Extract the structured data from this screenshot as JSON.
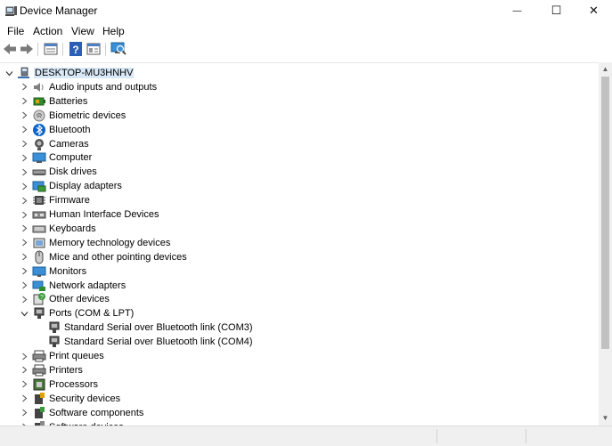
{
  "window": {
    "title": "Device Manager"
  },
  "window_controls": {
    "minimize": "—",
    "maximize": "☐",
    "close": "✕"
  },
  "menu": {
    "items": [
      "File",
      "Action",
      "View",
      "Help"
    ]
  },
  "tree": {
    "root": "DESKTOP-MU3HNHV",
    "categories": [
      {
        "label": "Audio inputs and outputs",
        "icon": "speaker-icon",
        "expanded": false
      },
      {
        "label": "Batteries",
        "icon": "battery-icon",
        "expanded": false
      },
      {
        "label": "Biometric devices",
        "icon": "fingerprint-icon",
        "expanded": false
      },
      {
        "label": "Bluetooth",
        "icon": "bluetooth-icon",
        "expanded": false
      },
      {
        "label": "Cameras",
        "icon": "camera-icon",
        "expanded": false
      },
      {
        "label": "Computer",
        "icon": "computer-icon",
        "expanded": false
      },
      {
        "label": "Disk drives",
        "icon": "disk-drive-icon",
        "expanded": false
      },
      {
        "label": "Display adapters",
        "icon": "display-adapter-icon",
        "expanded": false
      },
      {
        "label": "Firmware",
        "icon": "firmware-icon",
        "expanded": false
      },
      {
        "label": "Human Interface Devices",
        "icon": "hid-icon",
        "expanded": false
      },
      {
        "label": "Keyboards",
        "icon": "keyboard-icon",
        "expanded": false
      },
      {
        "label": "Memory technology devices",
        "icon": "memory-icon",
        "expanded": false
      },
      {
        "label": "Mice and other pointing devices",
        "icon": "mouse-icon",
        "expanded": false
      },
      {
        "label": "Monitors",
        "icon": "monitor-icon",
        "expanded": false
      },
      {
        "label": "Network adapters",
        "icon": "network-adapter-icon",
        "expanded": false
      },
      {
        "label": "Other devices",
        "icon": "unknown-device-icon",
        "expanded": false
      },
      {
        "label": "Ports (COM & LPT)",
        "icon": "port-icon",
        "expanded": true,
        "children": [
          "Standard Serial over Bluetooth link (COM3)",
          "Standard Serial over Bluetooth link (COM4)"
        ]
      },
      {
        "label": "Print queues",
        "icon": "print-queue-icon",
        "expanded": false
      },
      {
        "label": "Printers",
        "icon": "printer-icon",
        "expanded": false
      },
      {
        "label": "Processors",
        "icon": "processor-icon",
        "expanded": false
      },
      {
        "label": "Security devices",
        "icon": "security-device-icon",
        "expanded": false
      },
      {
        "label": "Software components",
        "icon": "software-component-icon",
        "expanded": false
      },
      {
        "label": "Software devices",
        "icon": "software-device-icon",
        "expanded": false
      }
    ]
  },
  "toolbar": {
    "buttons": [
      "back-icon",
      "forward-icon",
      "properties-icon",
      "help-icon",
      "update-view-icon",
      "scan-hardware-icon"
    ]
  },
  "colors": {
    "selection": "#d9e8f7",
    "accent": "#0078d7"
  }
}
